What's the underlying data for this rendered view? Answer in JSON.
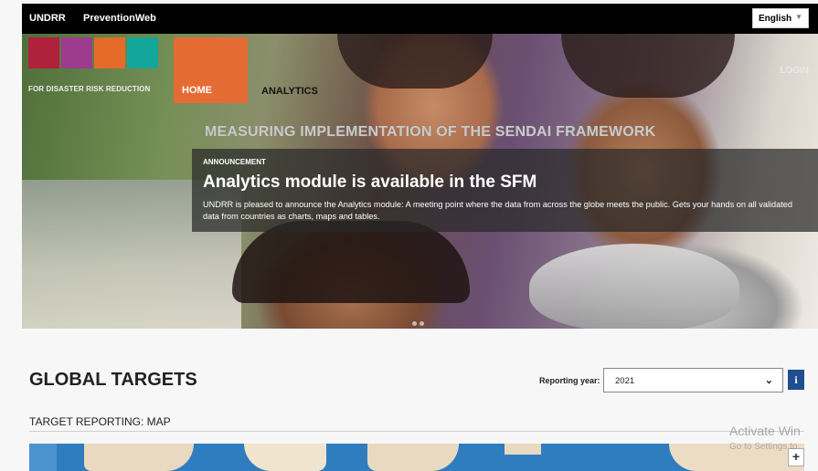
{
  "topbar": {
    "brand1": "UNDRR",
    "brand2": "PreventionWeb",
    "language": "English"
  },
  "logo": {
    "tagline": "FOR DISASTER RISK REDUCTION",
    "colors": [
      "#b0213c",
      "#9d3b8e",
      "#e56b2a",
      "#13a69a"
    ]
  },
  "nav": {
    "home": "HOME",
    "analytics": "ANALYTICS",
    "login": "LOGIN"
  },
  "hero": {
    "title": "MEASURING IMPLEMENTATION OF THE SENDAI FRAMEWORK",
    "kicker": "ANNOUNCEMENT",
    "headline": "Analytics module is available in the SFM",
    "body": "UNDRR is pleased to announce the Analytics module: A meeting point where the data from across the globe meets the public. Gets your hands on all validated data from countries as charts, maps and tables."
  },
  "global_targets": {
    "title": "GLOBAL TARGETS",
    "reporting_year_label": "Reporting year:",
    "reporting_year_value": "2021",
    "info_icon": "info-icon",
    "section_title": "TARGET REPORTING: MAP",
    "zoom_in": "+"
  },
  "overlay": {
    "line1": "Activate Win",
    "line2": "Go to Settings to"
  }
}
